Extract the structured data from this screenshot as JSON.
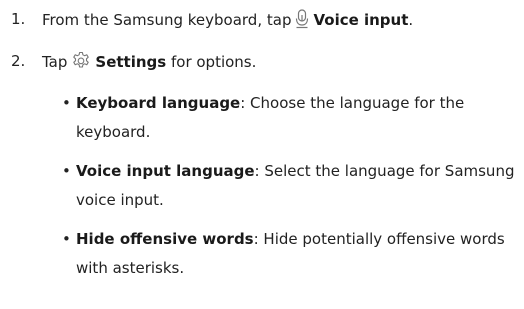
{
  "steps": [
    {
      "number": "1.",
      "prefix": "From the Samsung keyboard, tap",
      "icon": "microphone-icon",
      "bold": "Voice input",
      "suffix": "."
    },
    {
      "number": "2.",
      "prefix": "Tap",
      "icon": "gear-icon",
      "bold": "Settings",
      "suffix": " for options."
    }
  ],
  "options": [
    {
      "term": "Keyboard language",
      "description": ": Choose the language for the keyboard."
    },
    {
      "term": "Voice input language",
      "description": ": Select the language for Samsung voice input."
    },
    {
      "term": "Hide offensive words",
      "description": ": Hide potentially offensive words with asterisks."
    }
  ]
}
